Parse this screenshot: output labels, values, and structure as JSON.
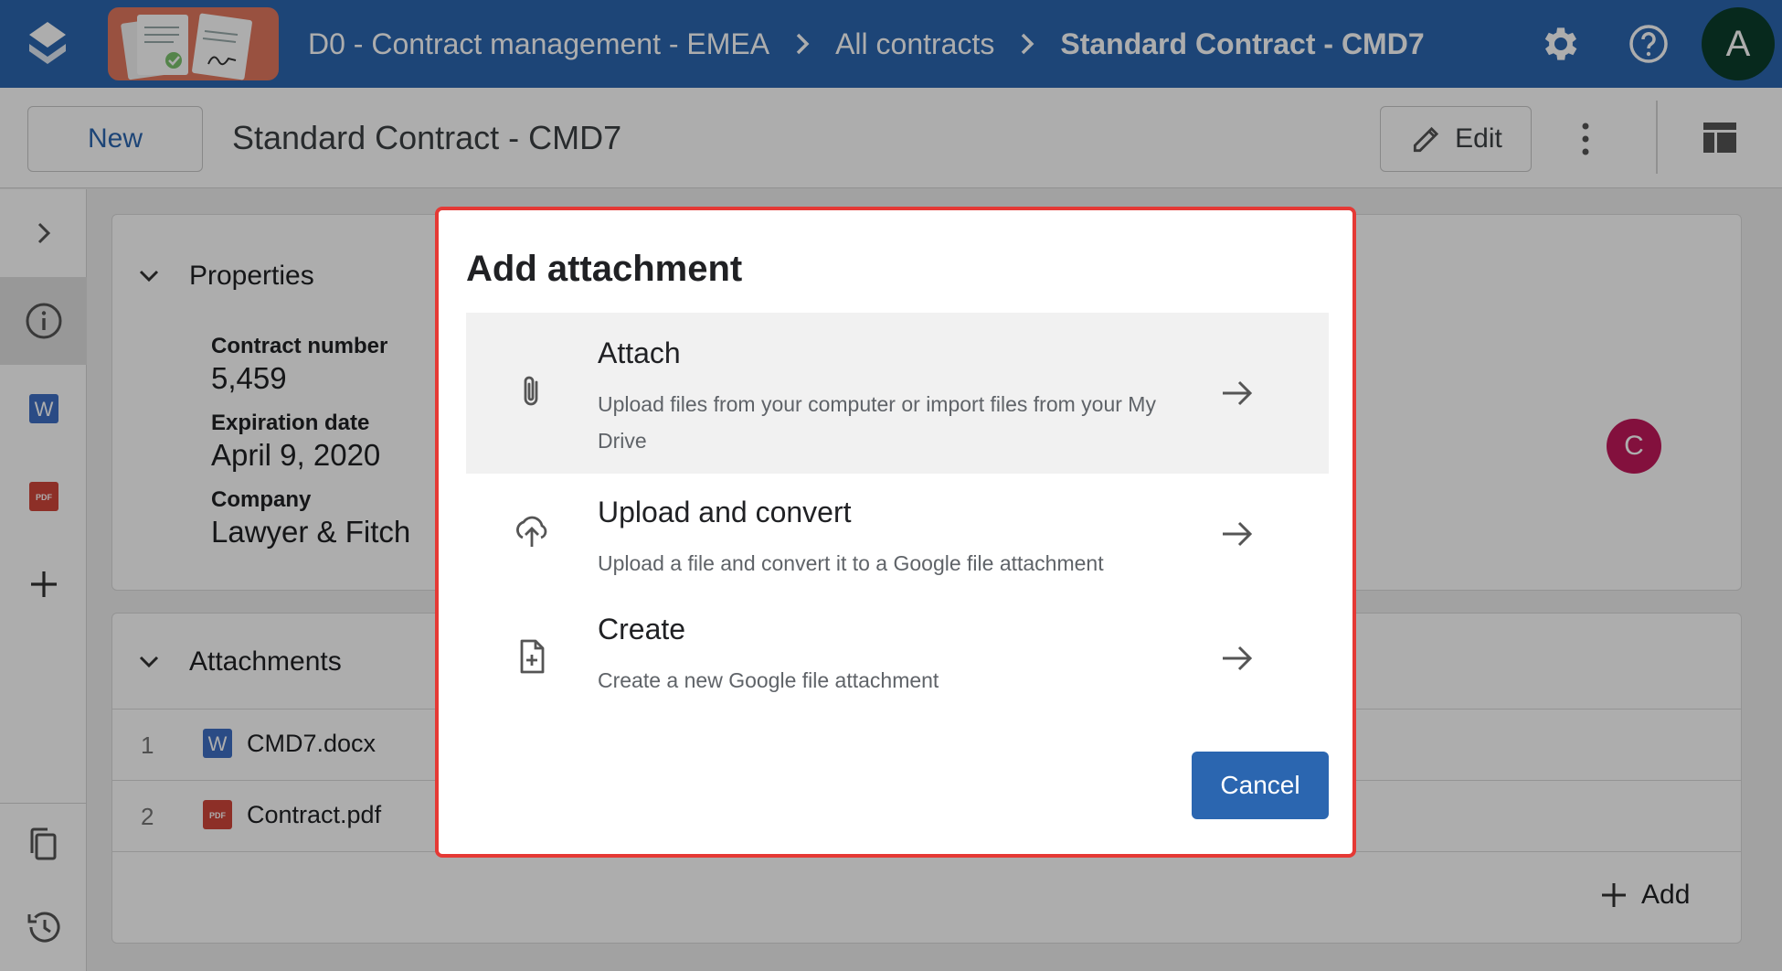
{
  "header": {
    "breadcrumbs": [
      {
        "label": "D0 - Contract management - EMEA"
      },
      {
        "label": "All contracts"
      },
      {
        "label": "Standard Contract - CMD7"
      }
    ],
    "avatar_letter": "A",
    "icons": [
      "app-logo-icon",
      "settings-gear-icon",
      "help-icon"
    ],
    "colors": {
      "bar": "#2b66b0",
      "avatar": "#0b3d2c"
    }
  },
  "toolbar": {
    "new_label": "New",
    "title": "Standard Contract - CMD7",
    "edit_label": "Edit"
  },
  "rail": {
    "items": [
      "expand-chevron-icon",
      "info-icon",
      "word-doc-icon",
      "pdf-icon",
      "add-icon",
      "copy-icon",
      "history-icon"
    ],
    "active": "info-icon"
  },
  "properties": {
    "title": "Properties",
    "fields": [
      {
        "label": "Contract number",
        "value": "5,459"
      },
      {
        "label": "Expiration date",
        "value": "April 9, 2020"
      },
      {
        "label": "Company",
        "value": "Lawyer & Fitch"
      }
    ],
    "assignee_initial": "C"
  },
  "attachments": {
    "title": "Attachments",
    "items": [
      {
        "num": "1",
        "name": "CMD7.docx",
        "type": "word"
      },
      {
        "num": "2",
        "name": "Contract.pdf",
        "type": "pdf"
      }
    ],
    "add_label": "Add"
  },
  "dialog": {
    "title": "Add attachment",
    "options": [
      {
        "title": "Attach",
        "desc": "Upload files from your computer or import files from your My Drive",
        "icon": "paperclip-icon"
      },
      {
        "title": "Upload and convert",
        "desc": "Upload a file and convert it to a Google file attachment",
        "icon": "upload-icon"
      },
      {
        "title": "Create",
        "desc": "Create a new Google file attachment",
        "icon": "new-file-icon"
      }
    ],
    "cancel_label": "Cancel",
    "colors": {
      "border": "#e53935",
      "primary": "#2b66b0"
    }
  }
}
